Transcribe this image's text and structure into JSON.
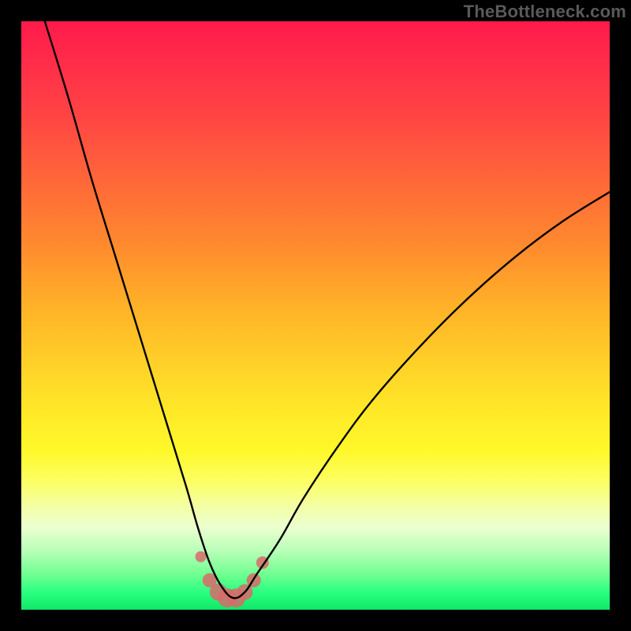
{
  "watermark": {
    "text": "TheBottleneck.com"
  },
  "chart_data": {
    "type": "line",
    "title": "",
    "xlabel": "",
    "ylabel": "",
    "xlim": [
      0,
      100
    ],
    "ylim": [
      0,
      100
    ],
    "grid": false,
    "legend": false,
    "notes": "Background: red (top) = high bottleneck, green (bottom) = no bottleneck. The black curve shows bottleneck % vs position; minimum near x≈35. Small pink markers sit near the curve's minimum.",
    "series": [
      {
        "name": "bottleneck-curve",
        "color": "#000000",
        "x": [
          4,
          8,
          12,
          16,
          20,
          24,
          28,
          30,
          32,
          34,
          36,
          38,
          40,
          44,
          48,
          54,
          60,
          68,
          76,
          84,
          92,
          100
        ],
        "y": [
          100,
          87,
          73,
          60,
          47,
          34,
          21,
          14,
          8,
          4,
          2,
          3,
          6,
          12,
          19,
          28,
          36,
          45,
          53,
          60,
          66,
          71
        ]
      }
    ],
    "markers": {
      "name": "highlight-dots",
      "color": "#d86a6a",
      "x": [
        30.5,
        32,
        33.5,
        35,
        36.5,
        38,
        39.5,
        41
      ],
      "y": [
        9,
        5,
        3,
        2,
        2,
        3,
        5,
        8
      ],
      "sizes": [
        7,
        9,
        11,
        12,
        12,
        10,
        9,
        8
      ]
    }
  }
}
